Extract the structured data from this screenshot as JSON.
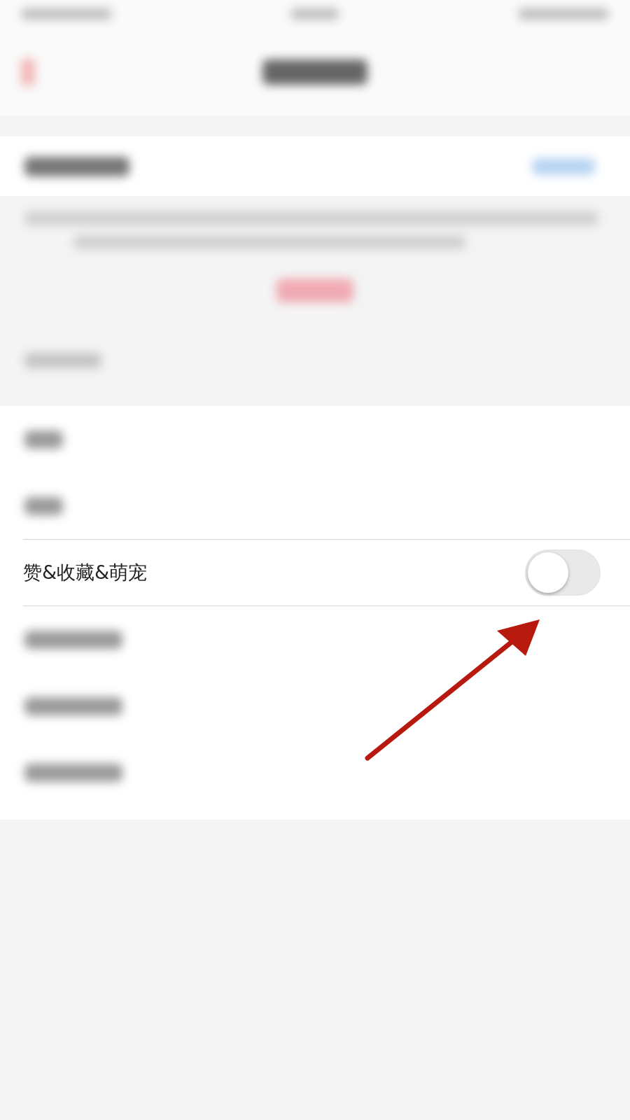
{
  "settings_rows": [
    {
      "label": "赞&收藏&萌宠",
      "on": false
    }
  ]
}
